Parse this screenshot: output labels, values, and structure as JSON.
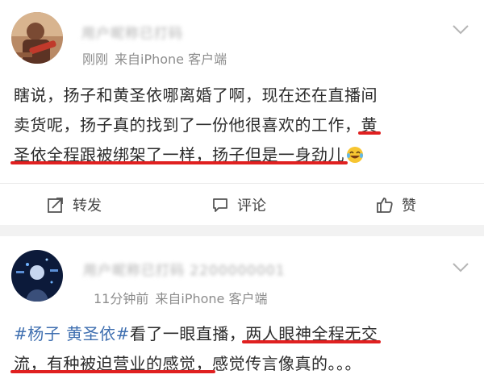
{
  "posts": [
    {
      "username": "用户昵称已打码",
      "time": "刚刚",
      "source": "来自iPhone 客户端",
      "text_lines": [
        [
          {
            "t": "瞎说，扬子和黄圣依哪离婚了啊，现在还在直播间"
          }
        ],
        [
          {
            "t": "卖货呢，扬子真的找到了一份他很喜欢的工作，"
          },
          {
            "t": "黄",
            "hl": true
          }
        ],
        [
          {
            "t": "圣依全程跟被绑架了一样，扬子但是一身劲儿",
            "hl": true
          },
          {
            "emoji": "laughing-tears-emoji"
          }
        ]
      ],
      "actions": {
        "repost_label": "转发",
        "comment_label": "评论",
        "like_label": "赞"
      }
    },
    {
      "username": "用户昵称已打码 2200000001",
      "time": "11分钟前",
      "source": "来自iPhone 客户端",
      "text_lines": [
        [
          {
            "t": "#杨子 黄圣依#",
            "tag": true
          },
          {
            "t": "看了一眼直播，"
          },
          {
            "t": "两人眼神全程无交",
            "hl": true
          }
        ],
        [
          {
            "t": "流，有种被迫营业的感觉，",
            "hl": true
          },
          {
            "t": "感觉传言像真的。。。"
          }
        ]
      ]
    }
  ],
  "colors": {
    "highlight": "#e02020",
    "hashtag": "#3f6fb0",
    "meta": "#8d8d8d",
    "text": "#2b2b2b"
  }
}
